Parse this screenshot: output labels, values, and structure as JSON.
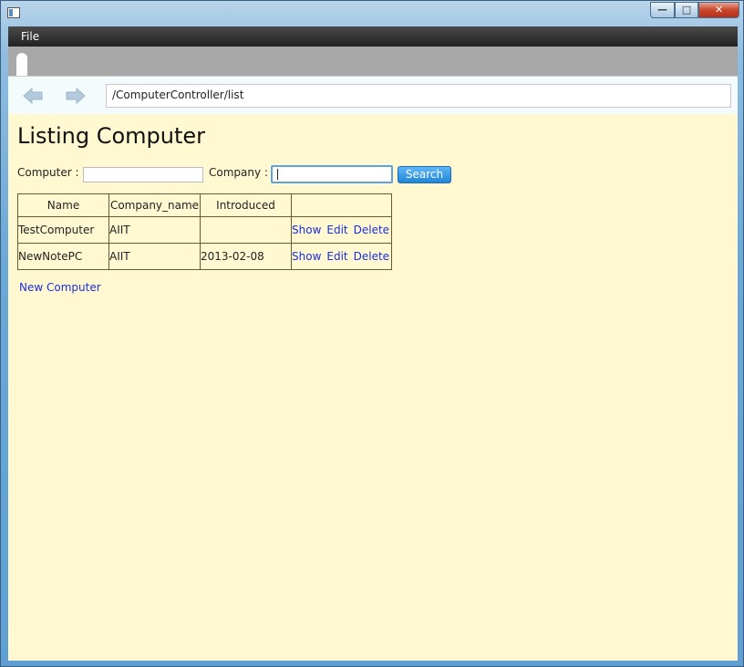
{
  "window": {
    "controls": {
      "minimize": "—",
      "maximize": "□",
      "close": "✕"
    }
  },
  "menu": {
    "file": "File"
  },
  "nav": {
    "url": "/ComputerController/list"
  },
  "page": {
    "title": "Listing Computer",
    "search": {
      "computer_label": "Computer :",
      "company_label": "Company :",
      "computer_value": "",
      "company_value": "",
      "button": "Search"
    },
    "table": {
      "headers": [
        "Name",
        "Company_name",
        "Introduced",
        ""
      ],
      "rows": [
        {
          "name": "TestComputer",
          "company": "AIIT",
          "introduced": "",
          "show": "Show",
          "edit": "Edit",
          "delete": "Delete"
        },
        {
          "name": "NewNotePC",
          "company": "AIIT",
          "introduced": "2013-02-08",
          "show": "Show",
          "edit": "Edit",
          "delete": "Delete"
        }
      ]
    },
    "new_link": "New Computer"
  },
  "colors": {
    "page_bg": "#fff8d0",
    "link": "#1a2ee0",
    "button": "#1f86d8"
  }
}
